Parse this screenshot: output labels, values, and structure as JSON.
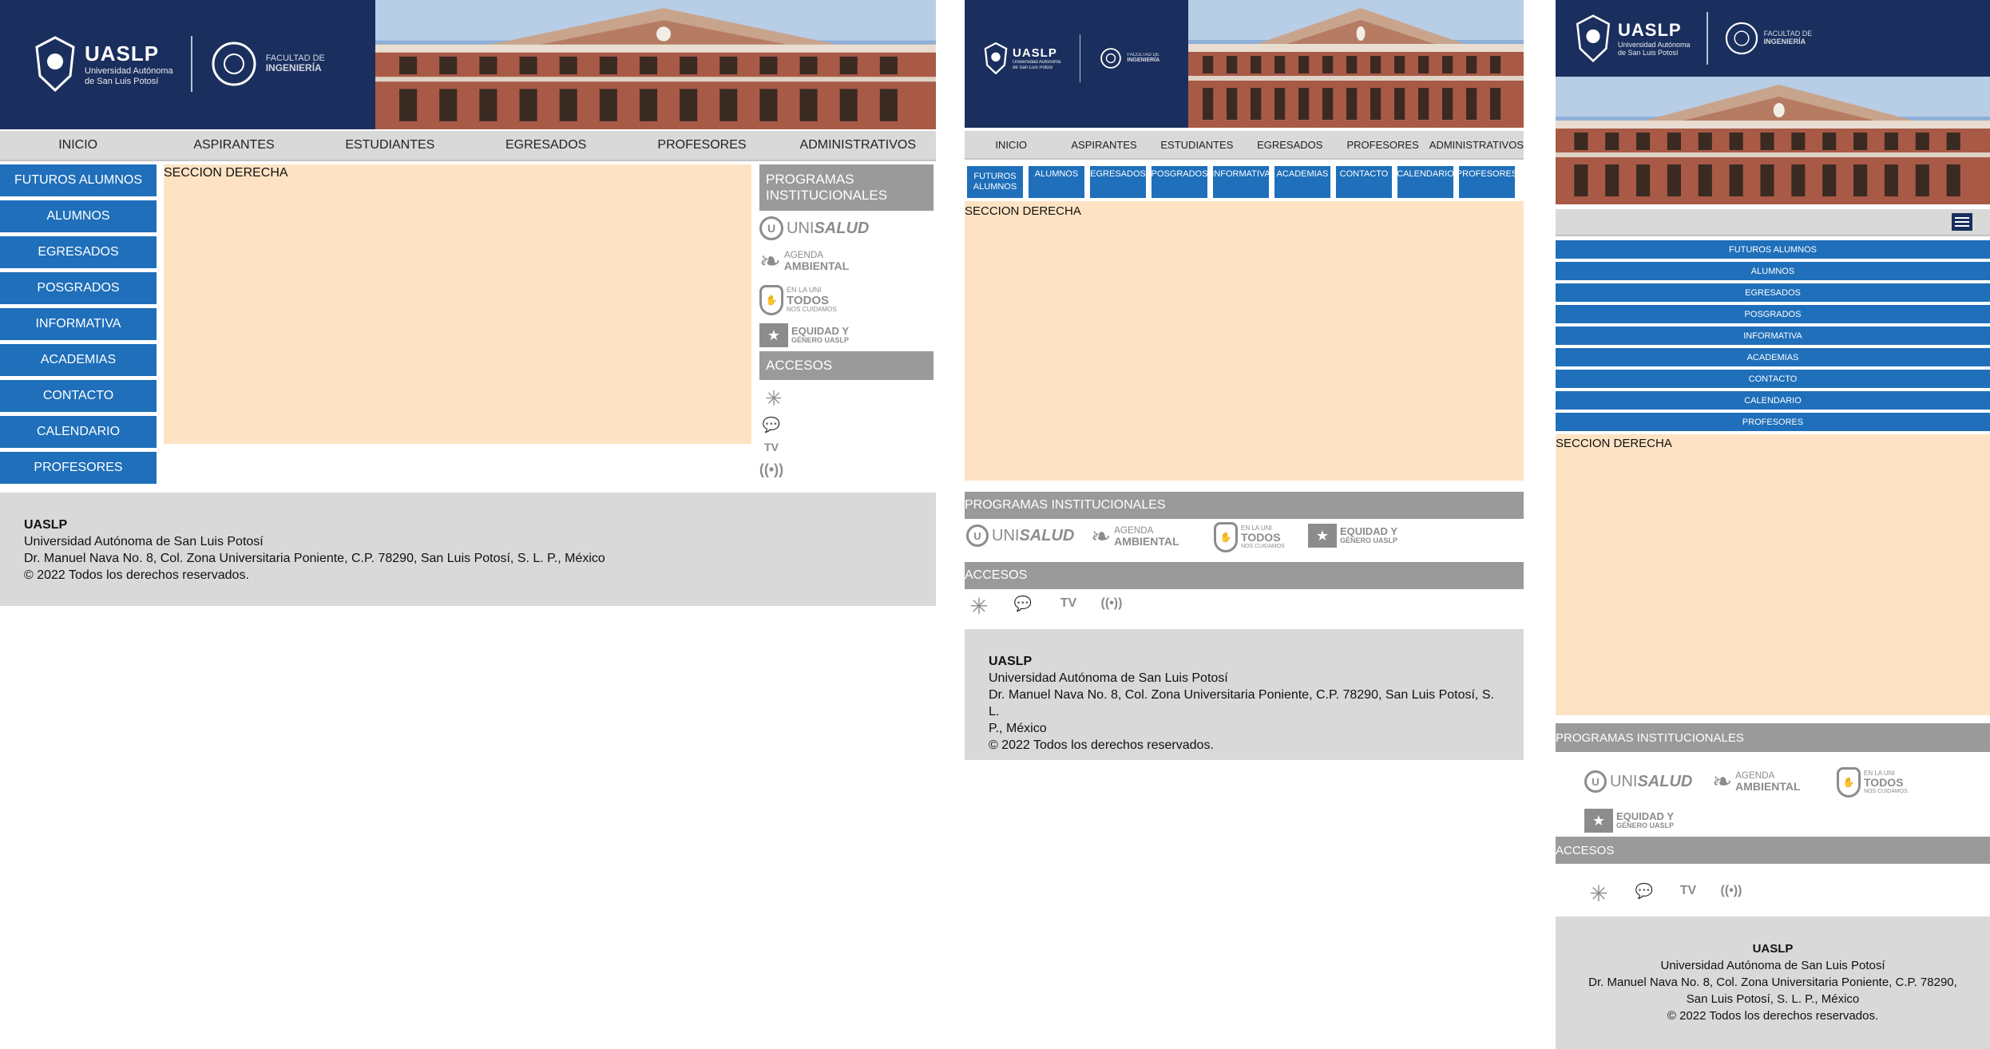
{
  "brand": {
    "name": "UASLP",
    "sub1": "Universidad Autónoma",
    "sub2": "de San Luis Potosí",
    "fac1": "FACULTAD DE",
    "fac2": "INGENIERÍA"
  },
  "topnav": [
    "INICIO",
    "ASPIRANTES",
    "ESTUDIANTES",
    "EGRESADOS",
    "PROFESORES",
    "ADMINISTRATIVOS"
  ],
  "sidemenu": [
    "FUTUROS ALUMNOS",
    "ALUMNOS",
    "EGRESADOS",
    "POSGRADOS",
    "INFORMATIVA",
    "ACADEMIAS",
    "CONTACTO",
    "CALENDARIO",
    "PROFESORES"
  ],
  "midmenu": [
    "FUTUROS ALUMNOS",
    "ALUMNOS",
    "EGRESADOS",
    "POSGRADOS",
    "INFORMATIVA",
    "ACADEMIAS",
    "CONTACTO",
    "CALENDARIO",
    "PROFESORES"
  ],
  "seccion": "SECCION DERECHA",
  "programs": {
    "title": "PROGRAMAS INSTITUCIONALES",
    "title_l1": "PROGRAMAS",
    "title_l2": "INSTITUCIONALES",
    "unisalud_a": "UNI",
    "unisalud_b": "SALUD",
    "agenda_a": "AGENDA",
    "agenda_b": "AMBIENTAL",
    "todos_a": "EN LA UNI",
    "todos_b": "TODOS",
    "todos_c": "NOS CUIDAMOS",
    "equidad_a": "EQUIDAD Y",
    "equidad_b": "GÉNERO UASLP"
  },
  "accesos": "ACCESOS",
  "footer": {
    "name": "UASLP",
    "line1": "Universidad Autónoma de San Luis Potosí",
    "line2": "Dr. Manuel Nava No. 8, Col. Zona Universitaria Poniente, C.P. 78290, San Luis Potosí, S. L. P., México",
    "line2a": "Dr. Manuel Nava No. 8, Col. Zona Universitaria Poniente, C.P. 78290, San Luis Potosí, S. L.",
    "line2b": "P., México",
    "line2c": "Dr. Manuel Nava No. 8, Col. Zona Universitaria Poniente, C.P. 78290,",
    "line2d": "San Luis Potosí, S. L. P., México",
    "line3": "© 2022 Todos los derechos reservados."
  },
  "colors": {
    "navy": "#1b2f5e",
    "blue": "#1f6fba",
    "peach": "#fde3c3",
    "gray": "#9a9a9a",
    "light": "#d9d9d9"
  }
}
